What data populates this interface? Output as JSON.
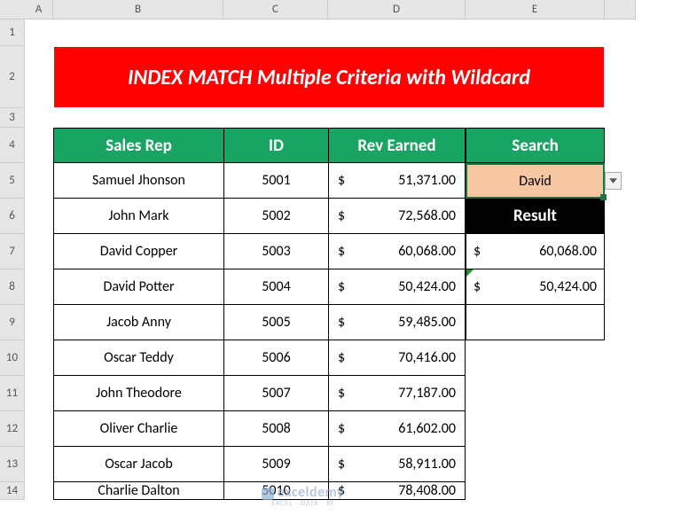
{
  "columns": [
    "A",
    "B",
    "C",
    "D",
    "E"
  ],
  "rows": [
    "1",
    "2",
    "3",
    "4",
    "5",
    "6",
    "7",
    "8",
    "9",
    "10",
    "11",
    "12",
    "13",
    "14"
  ],
  "title": "INDEX MATCH Multiple Criteria with Wildcard",
  "headers": {
    "b": "Sales Rep",
    "c": "ID",
    "d": "Rev Earned",
    "e": "Search"
  },
  "search": {
    "value": "David",
    "resultLabel": "Result"
  },
  "results": [
    {
      "sym": "$",
      "amt": "60,068.00",
      "flag": false
    },
    {
      "sym": "$",
      "amt": "50,424.00",
      "flag": true
    }
  ],
  "table": [
    {
      "rep": "Samuel Jhonson",
      "id": "5001",
      "sym": "$",
      "amt": "51,371.00"
    },
    {
      "rep": "John Mark",
      "id": "5002",
      "sym": "$",
      "amt": "72,568.00"
    },
    {
      "rep": "David Copper",
      "id": "5003",
      "sym": "$",
      "amt": "60,068.00"
    },
    {
      "rep": "David Potter",
      "id": "5004",
      "sym": "$",
      "amt": "50,424.00"
    },
    {
      "rep": "Jacob Anny",
      "id": "5005",
      "sym": "$",
      "amt": "59,485.00"
    },
    {
      "rep": "Oscar Teddy",
      "id": "5006",
      "sym": "$",
      "amt": "70,416.00"
    },
    {
      "rep": "John Theodore",
      "id": "5007",
      "sym": "$",
      "amt": "77,187.00"
    },
    {
      "rep": "Oliver Charlie",
      "id": "5008",
      "sym": "$",
      "amt": "61,602.00"
    },
    {
      "rep": "Oscar Jacob",
      "id": "5009",
      "sym": "$",
      "amt": "58,911.00"
    },
    {
      "rep": "Charlie Dalton",
      "id": "5010",
      "sym": "$",
      "amt": "78,408.00"
    }
  ],
  "watermark": {
    "line1": "exceldemy",
    "line2": "EXCEL · DATA · BI"
  },
  "chart_data": {
    "type": "table",
    "title": "INDEX MATCH Multiple Criteria with Wildcard",
    "columns": [
      "Sales Rep",
      "ID",
      "Rev Earned"
    ],
    "rows": [
      [
        "Samuel Jhonson",
        5001,
        51371.0
      ],
      [
        "John Mark",
        5002,
        72568.0
      ],
      [
        "David Copper",
        5003,
        60068.0
      ],
      [
        "David Potter",
        5004,
        50424.0
      ],
      [
        "Jacob Anny",
        5005,
        59485.0
      ],
      [
        "Oscar Teddy",
        5006,
        70416.0
      ],
      [
        "John Theodore",
        5007,
        77187.0
      ],
      [
        "Oliver Charlie",
        5008,
        61602.0
      ],
      [
        "Oscar Jacob",
        5009,
        58911.0
      ],
      [
        "Charlie Dalton",
        5010,
        78408.0
      ]
    ],
    "search_term": "David",
    "search_results": [
      60068.0,
      50424.0
    ]
  }
}
